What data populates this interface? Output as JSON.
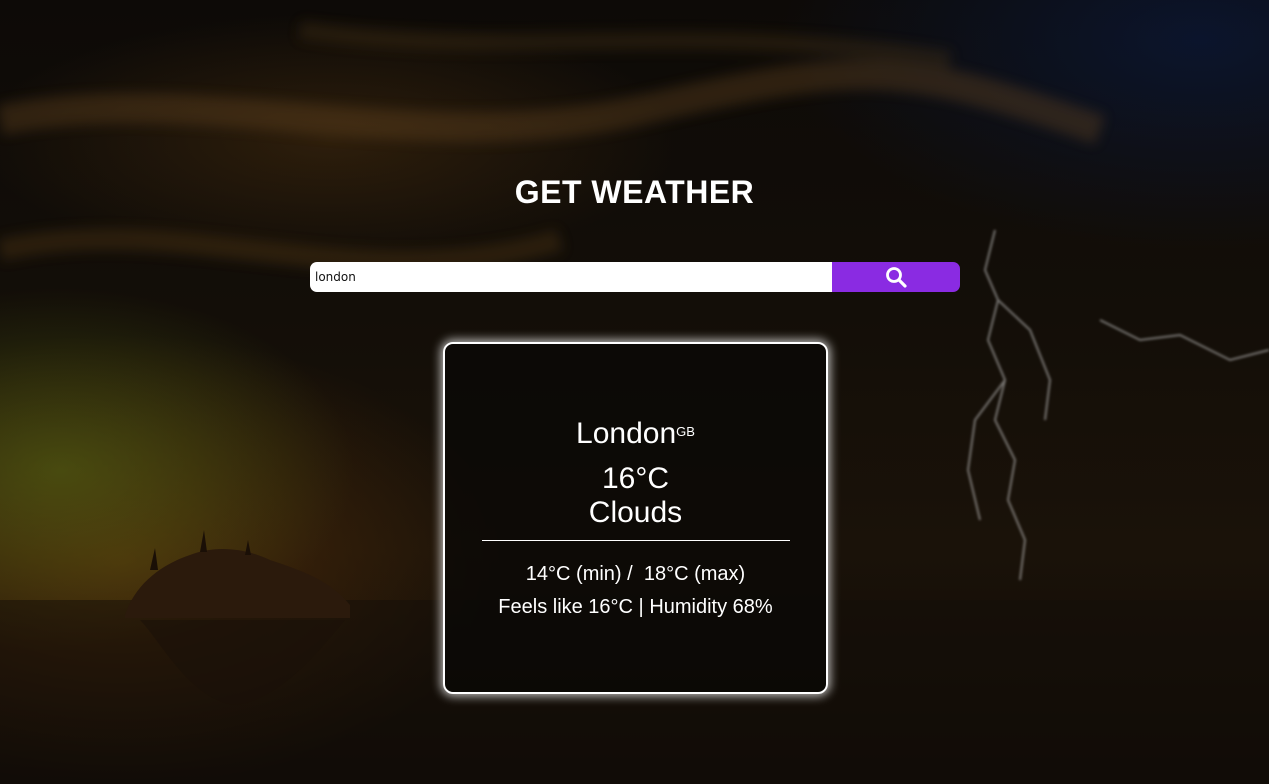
{
  "page": {
    "title": "GET WEATHER"
  },
  "search": {
    "value": "london",
    "placeholder": "",
    "button_icon": "search-icon",
    "button_color": "#8a2be2"
  },
  "weather": {
    "city": "London",
    "country": "GB",
    "temperature": "16°C",
    "condition": "Clouds",
    "min_temp": "14°C (min)",
    "separator": " /  ",
    "max_temp": "18°C (max)",
    "feels_like": "Feels like 16°C",
    "details_separator": " | ",
    "humidity": "Humidity 68%"
  },
  "colors": {
    "accent": "#8a2be2",
    "text": "#ffffff"
  }
}
